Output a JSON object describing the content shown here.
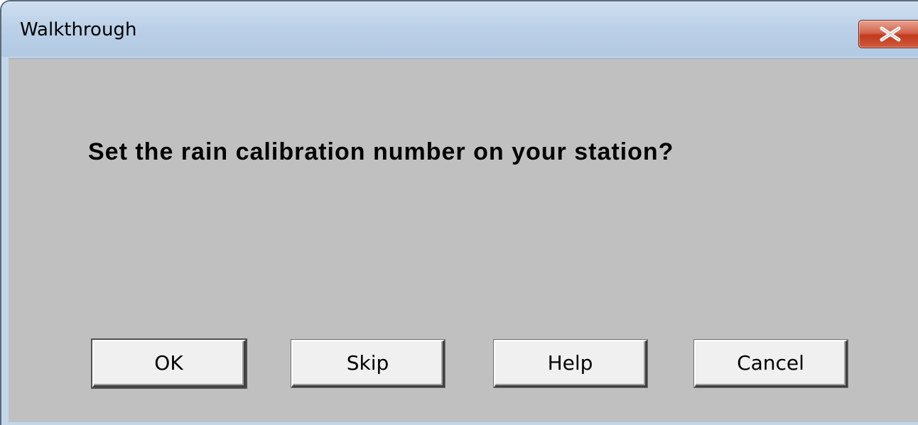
{
  "window": {
    "title": "Walkthrough",
    "close_icon": "close-x-icon"
  },
  "dialog": {
    "prompt": "Set the rain calibration number on your station?"
  },
  "buttons": {
    "ok_label": "OK",
    "skip_label": "Skip",
    "help_label": "Help",
    "cancel_label": "Cancel"
  },
  "colors": {
    "client_bg": "#c0c0c0",
    "titlebar_bg": "#bcd1e8",
    "close_button": "#c23a1e"
  }
}
